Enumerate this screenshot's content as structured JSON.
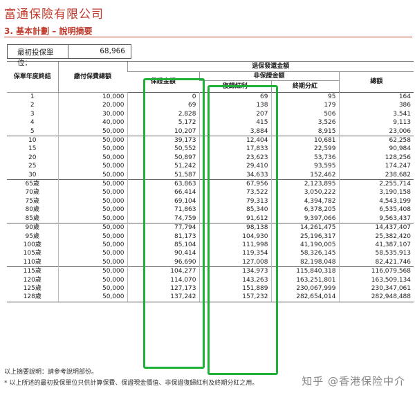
{
  "header": {
    "company": "富通保險有限公司",
    "section": "3.  基本計劃 – 說明摘要"
  },
  "units": {
    "label": "最初投保單位",
    "colon": "：",
    "value": "68,966"
  },
  "table": {
    "col_year_end": "保單年度終結",
    "col_premium": "繳付保費總額",
    "col_surrender": "退保發還金額",
    "col_guaranteed": "保證金額",
    "col_nonguaranteed": "非保證金額",
    "col_reversionary": "復歸紅利",
    "col_terminal": "終期分紅",
    "col_total": "總額",
    "groups": [
      [
        [
          "1",
          "10,000",
          "0",
          "69",
          "95",
          "164"
        ],
        [
          "2",
          "20,000",
          "69",
          "138",
          "179",
          "386"
        ],
        [
          "3",
          "30,000",
          "2,828",
          "207",
          "506",
          "3,541"
        ],
        [
          "4",
          "40,000",
          "5,172",
          "415",
          "3,526",
          "9,113"
        ],
        [
          "5",
          "50,000",
          "10,207",
          "3,884",
          "8,915",
          "23,006"
        ]
      ],
      [
        [
          "10",
          "50,000",
          "39,173",
          "12,404",
          "10,681",
          "62,258"
        ],
        [
          "15",
          "50,000",
          "50,552",
          "17,833",
          "22,599",
          "90,984"
        ],
        [
          "20",
          "50,000",
          "50,897",
          "23,623",
          "53,736",
          "128,256"
        ],
        [
          "25",
          "50,000",
          "51,242",
          "29,410",
          "93,595",
          "174,247"
        ],
        [
          "30",
          "50,000",
          "51,587",
          "34,633",
          "152,462",
          "238,682"
        ]
      ],
      [
        [
          "65歲",
          "50,000",
          "63,863",
          "67,956",
          "2,123,895",
          "2,255,714"
        ],
        [
          "70歲",
          "50,000",
          "66,414",
          "73,522",
          "3,050,222",
          "3,190,158"
        ],
        [
          "75歲",
          "50,000",
          "69,104",
          "79,313",
          "4,394,782",
          "4,543,199"
        ],
        [
          "80歲",
          "50,000",
          "71,863",
          "85,340",
          "6,378,205",
          "6,535,408"
        ],
        [
          "85歲",
          "50,000",
          "74,759",
          "91,612",
          "9,397,066",
          "9,563,437"
        ]
      ],
      [
        [
          "90歲",
          "50,000",
          "77,794",
          "98,138",
          "14,261,475",
          "14,437,407"
        ],
        [
          "95歲",
          "50,000",
          "81,173",
          "104,930",
          "25,196,317",
          "25,382,420"
        ],
        [
          "100歲",
          "50,000",
          "85,104",
          "111,998",
          "41,190,005",
          "41,387,107"
        ],
        [
          "105歲",
          "50,000",
          "90,414",
          "119,354",
          "58,326,145",
          "58,535,913"
        ],
        [
          "110歲",
          "50,000",
          "96,690",
          "127,008",
          "82,198,048",
          "82,421,746"
        ]
      ],
      [
        [
          "115歲",
          "50,000",
          "104,277",
          "134,973",
          "115,840,318",
          "116,079,568"
        ],
        [
          "120歲",
          "50,000",
          "114,070",
          "143,263",
          "163,251,801",
          "163,509,134"
        ],
        [
          "125歲",
          "50,000",
          "127,173",
          "151,889",
          "230,067,999",
          "230,347,061"
        ],
        [
          "128歲",
          "50,000",
          "137,242",
          "157,232",
          "282,654,014",
          "282,948,488"
        ]
      ]
    ]
  },
  "notes": {
    "line1": "以上摘要說明：請參考說明部份。",
    "line2": "*  以上所述的最初投保單位只供計算保費、保證現金價值、非保證復歸紅利及終期分紅之用。"
  },
  "watermark": "知乎 @香港保险中介",
  "colors": {
    "title": "#c0392b",
    "highlight": "#1fb03a"
  }
}
